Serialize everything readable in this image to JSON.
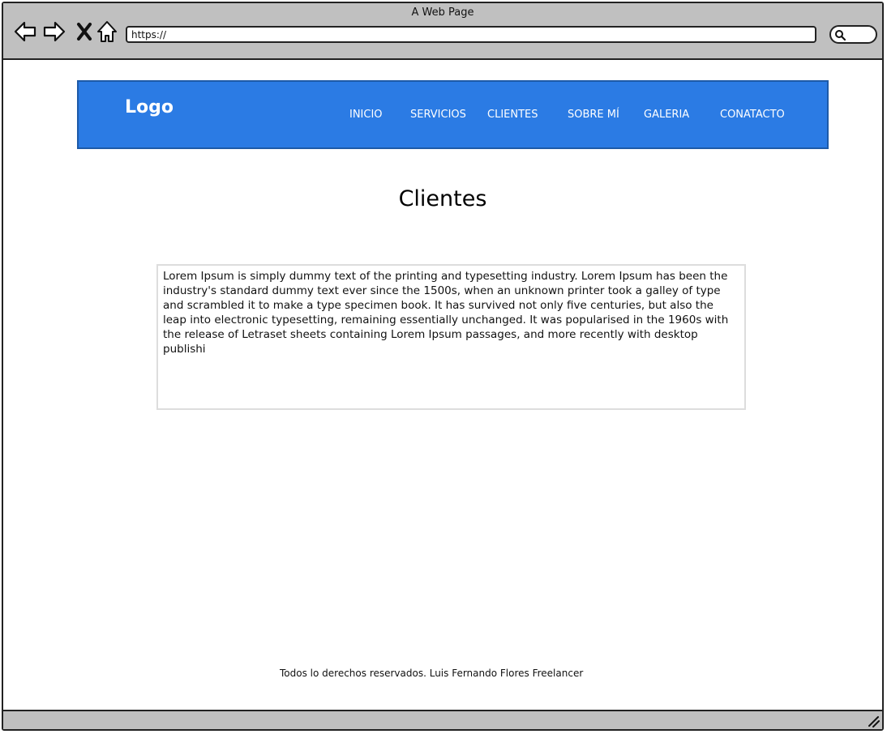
{
  "window": {
    "title": "A Web Page",
    "address": "https://"
  },
  "header": {
    "logo": "Logo",
    "menu": [
      {
        "label": "INICIO"
      },
      {
        "label": "SERVICIOS"
      },
      {
        "label": "CLIENTES"
      },
      {
        "label": "SOBRE MÍ"
      },
      {
        "label": "GALERIA"
      },
      {
        "label": "CONATACTO"
      }
    ]
  },
  "main": {
    "title": "Clientes",
    "body_text": "Lorem Ipsum is simply dummy text of the printing and typesetting industry. Lorem Ipsum has been the industry's standard dummy text ever since the 1500s, when an unknown printer took a galley of type and scrambled it to make a type specimen book. It has survived not only five centuries, but also the leap into electronic typesetting, remaining essentially unchanged. It was popularised in the 1960s with the release of Letraset sheets containing Lorem Ipsum passages, and more recently with desktop publishi"
  },
  "footer": {
    "text": "Todos lo derechos reservados. Luis Fernando Flores Freelancer"
  },
  "colors": {
    "header_bg": "#2b7be4",
    "header_border": "#1d5aa8",
    "chrome_gray": "#c0c0c0"
  },
  "icons": [
    "back-arrow-icon",
    "forward-arrow-icon",
    "stop-icon",
    "home-icon",
    "search-icon",
    "resize-grip-icon"
  ]
}
